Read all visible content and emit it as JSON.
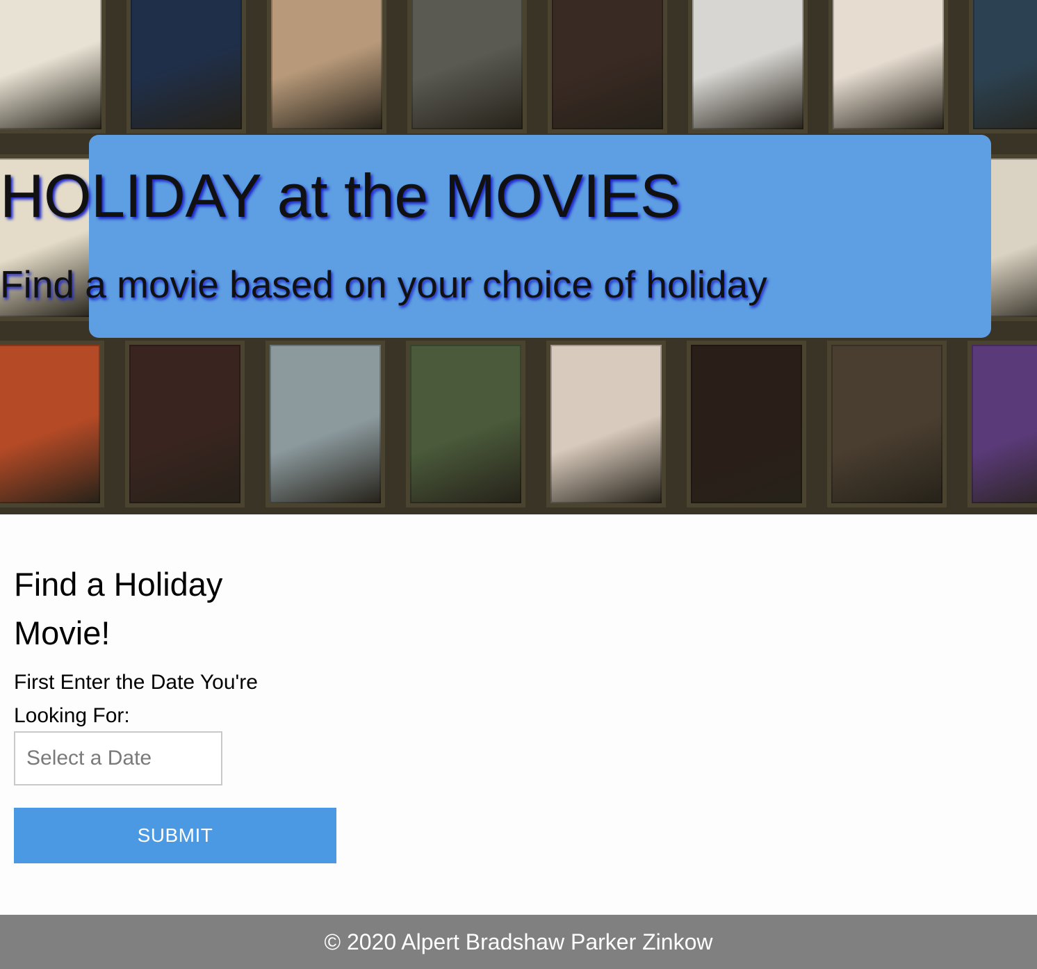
{
  "hero": {
    "title": "HOLIDAY at the MOVIES",
    "subtitle": "Find a movie based on your choice of holiday",
    "poster_rows": [
      [
        "#e8e2d4",
        "#1f2f4a",
        "#b89a7a",
        "#5a5a52",
        "#3a2a24",
        "#d8d6d2",
        "#e6dcd0",
        "#2c4252"
      ],
      [
        "#e4dcc8",
        "#e8e6e2",
        "#d2cbb8",
        "#cfc6b2",
        "#bfb49c",
        "#e2ddd5",
        "#ece8e2",
        "#dad2c2"
      ],
      [
        "#b44a26",
        "#3a2420",
        "#8c9a9e",
        "#4a5a3a",
        "#d8cabc",
        "#2a1e18",
        "#4a3e30",
        "#5a3a78"
      ]
    ]
  },
  "finder": {
    "heading": "Find a Holiday Movie!",
    "date_label": "First Enter the Date You're Looking For:",
    "date_input_value": "",
    "date_input_placeholder": "Select a Date",
    "submit_label": "SUBMIT"
  },
  "footer": {
    "copyright": "© 2020 Alpert Bradshaw Parker Zinkow"
  }
}
